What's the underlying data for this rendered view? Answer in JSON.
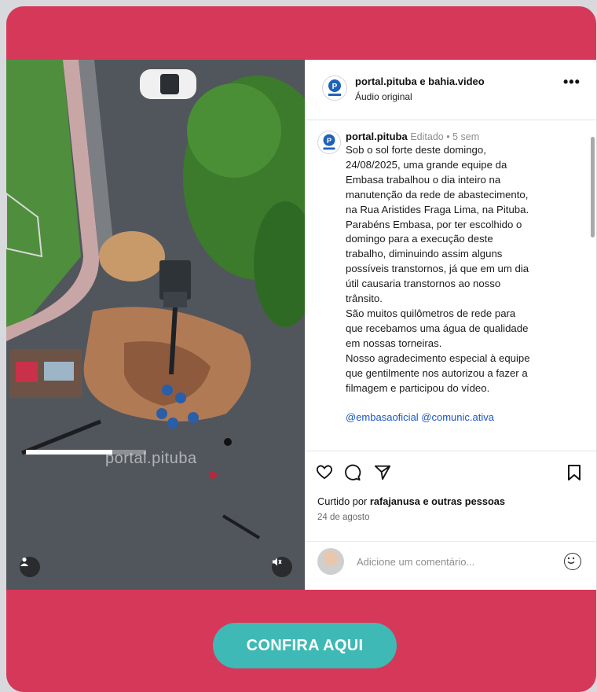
{
  "post": {
    "header_user": "portal.pituba e bahia.video",
    "header_audio": "Áudio original",
    "caption_user": "portal.pituba",
    "caption_meta": "Editado • 5 sem",
    "caption_text": "Sob o sol forte deste domingo,\n24/08/2025, uma grande equipe da\nEmbasa trabalhou o dia inteiro na\nmanutenção da rede de abastecimento,\nna Rua Aristides Fraga Lima, na Pituba.\nParabéns Embasa, por ter escolhido o\ndomingo para a execução deste\ntrabalho, diminuindo assim alguns\npossíveis transtornos, já que em um dia\nútil causaria transtornos ao nosso\ntrânsito.\nSão muitos quilômetros de rede para\nque recebamos uma água de qualidade\nem nossas torneiras.\nNosso agradecimento especial à equipe\nque gentilmente nos autorizou a fazer a\nfilmagem e participou do vídeo.",
    "caption_tags": "@embasaoficial @comunic.ativa",
    "likes_prefix": "Curtido por",
    "likes_user": "rafajanusa",
    "likes_suffix": "e outras pessoas",
    "date": "24 de agosto",
    "comment_placeholder": "Adicione um comentário..."
  },
  "video": {
    "watermark": "portal.pituba",
    "progress": 0.72
  },
  "cta": {
    "label": "CONFIRA AQUI"
  },
  "colors": {
    "brand_red": "#d6385a",
    "button_teal": "#3fb9b5",
    "link_blue": "#1b56c4"
  },
  "icons": [
    "heart-icon",
    "comment-icon",
    "share-icon",
    "bookmark-icon",
    "more-icon",
    "user-icon",
    "mute-icon",
    "emoji-icon"
  ]
}
